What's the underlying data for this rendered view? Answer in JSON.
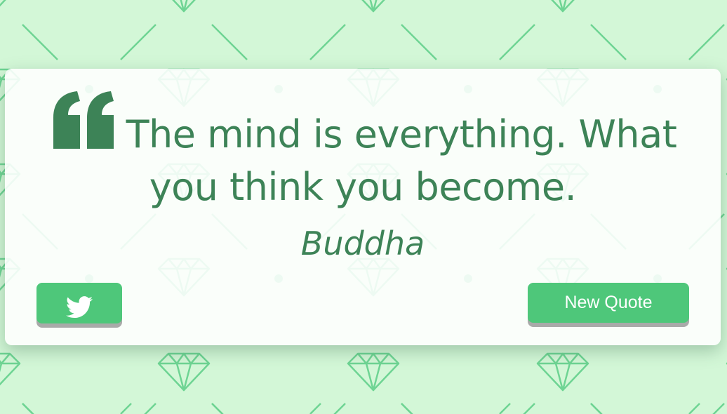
{
  "quote": {
    "text": "The mind is everything. What you think you become.",
    "author": "Buddha"
  },
  "buttons": {
    "tweet_icon": "twitter-bird-icon",
    "new_quote_label": "New Quote"
  },
  "colors": {
    "background": "#d3f7d7",
    "pattern": "#6ed493",
    "text": "#3d8357",
    "button": "#4ec77a",
    "button_shadow": "#a9aaa9"
  }
}
